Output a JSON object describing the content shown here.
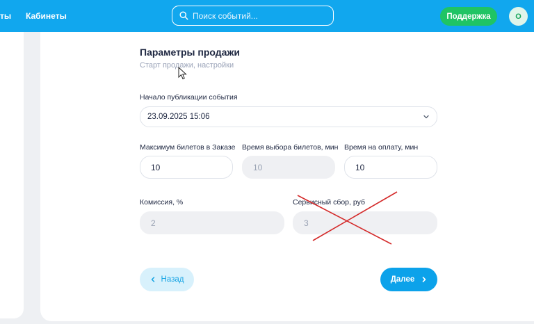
{
  "header": {
    "nav_truncated": "ты",
    "nav_cabinets": "Кабинеты",
    "search_placeholder": "Поиск событий...",
    "support_label": "Поддержка",
    "avatar_letter": "О"
  },
  "form": {
    "title": "Параметры продажи",
    "subtitle": "Старт продажи, настройки",
    "publication_start": {
      "label": "Начало публикации события",
      "value": "23.09.2025 15:06"
    },
    "max_tickets": {
      "label": "Максимум билетов в Заказе",
      "value": "10"
    },
    "ticket_select_time": {
      "label": "Время выбора билетов, мин",
      "value": "10"
    },
    "payment_time": {
      "label": "Время на оплату, мин",
      "value": "10"
    },
    "commission": {
      "label": "Комиссия, %",
      "value": "2"
    },
    "service_fee": {
      "label": "Сервисный сбор, руб",
      "value": "3"
    },
    "back_label": "Назад",
    "next_label": "Далее"
  },
  "colors": {
    "brand": "#11a7ee",
    "support": "#1fc464",
    "annotation_cross": "#d42a2a"
  }
}
